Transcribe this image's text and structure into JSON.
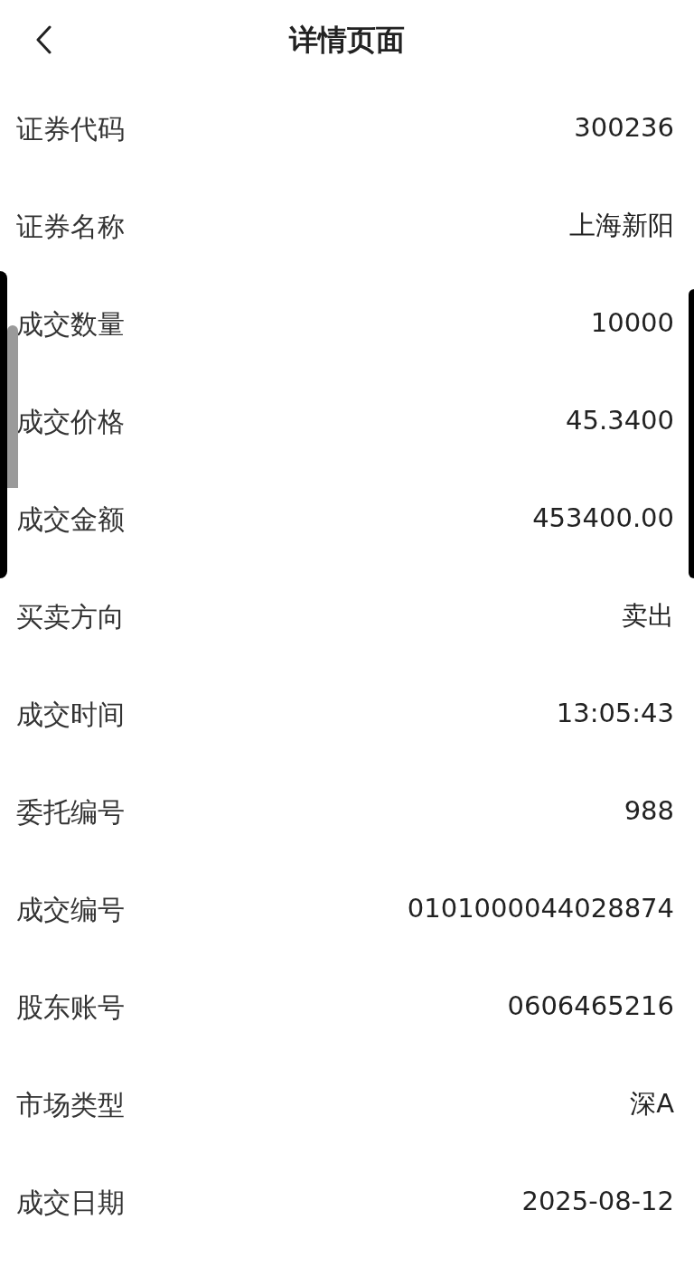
{
  "header": {
    "title": "详情页面"
  },
  "rows": [
    {
      "label": "证券代码",
      "value": "300236"
    },
    {
      "label": "证券名称",
      "value": "上海新阳"
    },
    {
      "label": "成交数量",
      "value": "10000"
    },
    {
      "label": "成交价格",
      "value": "45.3400"
    },
    {
      "label": "成交金额",
      "value": "453400.00"
    },
    {
      "label": "买卖方向",
      "value": "卖出"
    },
    {
      "label": "成交时间",
      "value": "13:05:43"
    },
    {
      "label": "委托编号",
      "value": "988"
    },
    {
      "label": "成交编号",
      "value": "0101000044028874"
    },
    {
      "label": "股东账号",
      "value": "0606465216"
    },
    {
      "label": "市场类型",
      "value": "深A"
    },
    {
      "label": "成交日期",
      "value": "2025-08-12"
    }
  ]
}
